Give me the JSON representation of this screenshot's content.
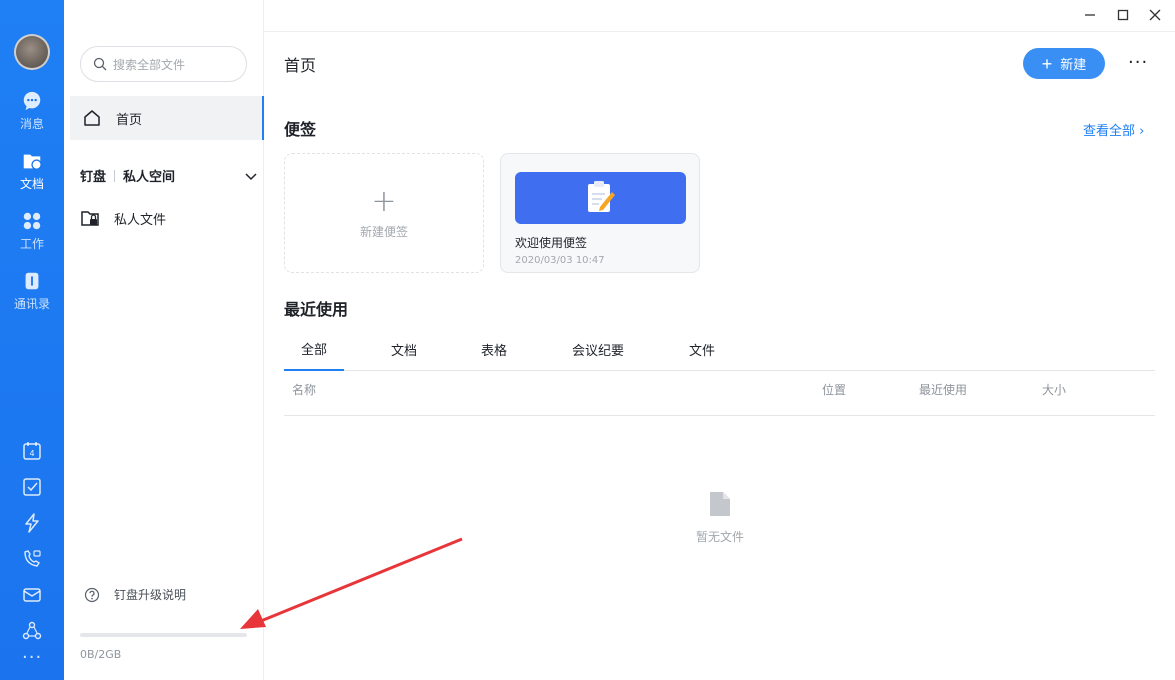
{
  "rail": {
    "items": [
      {
        "label": "消息",
        "icon": "chat-icon"
      },
      {
        "label": "文档",
        "icon": "document-icon"
      },
      {
        "label": "工作",
        "icon": "apps-icon"
      },
      {
        "label": "通讯录",
        "icon": "contacts-icon"
      }
    ],
    "active": "文档",
    "bottom_icons": [
      "calendar-icon",
      "todo-check-icon",
      "lightning-icon",
      "phone-video-icon",
      "mail-icon",
      "network-icon"
    ],
    "calendar_day": "4",
    "more": "···"
  },
  "panel": {
    "search_placeholder": "搜索全部文件",
    "home_label": "首页",
    "section_a": "钉盘",
    "section_b": "私人空间",
    "private_files": "私人文件",
    "upgrade_label": "钉盘升级说明",
    "storage_text": "0B/2GB",
    "storage_used_fraction": 0
  },
  "main": {
    "title": "首页",
    "new_button": "新建",
    "more": "···",
    "notes_title": "便签",
    "view_all": "查看全部 ›",
    "new_note": "新建便签",
    "note": {
      "name": "欢迎使用便签",
      "time": "2020/03/03 10:47"
    },
    "recent_title": "最近使用",
    "tabs": [
      "全部",
      "文档",
      "表格",
      "会议纪要",
      "文件"
    ],
    "active_tab": "全部",
    "columns": {
      "name": "名称",
      "location": "位置",
      "last_used": "最近使用",
      "size": "大小"
    },
    "empty_text": "暂无文件"
  },
  "colors": {
    "accent": "#1f7ff4",
    "rail": "#1b74ee",
    "button": "#3a8ff5",
    "annotation_arrow": "#e8353a"
  }
}
